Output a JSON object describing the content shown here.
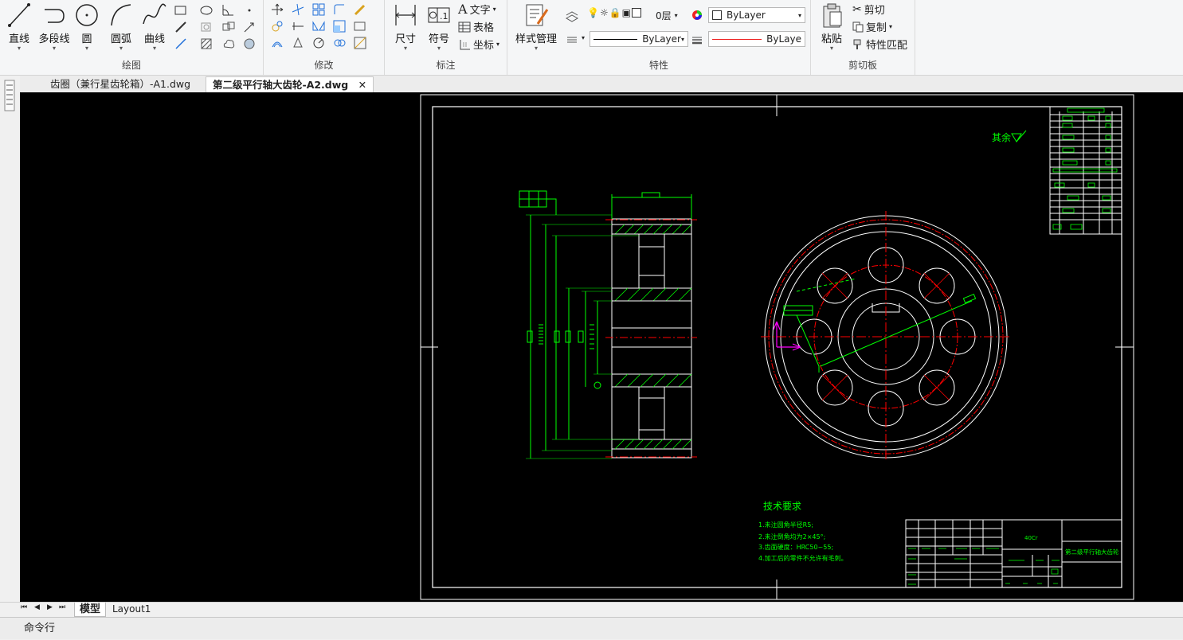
{
  "ribbon": {
    "draw": {
      "title": "绘图",
      "line": "直线",
      "polyline": "多段线",
      "circle": "圆",
      "arc": "圆弧",
      "curve": "曲线"
    },
    "modify": {
      "title": "修改"
    },
    "annotation": {
      "title": "标注",
      "dimension": "尺寸",
      "symbol": "符号",
      "text": "文字",
      "table": "表格",
      "coordinate": "坐标"
    },
    "properties": {
      "title": "特性",
      "style_manager": "样式管理",
      "layer": "0层",
      "color": "ByLayer",
      "linetype": "ByLayer",
      "lineweight": "ByLaye"
    },
    "clipboard": {
      "title": "剪切板",
      "paste": "粘贴",
      "cut": "剪切",
      "copy": "复制",
      "match_properties": "特性匹配"
    }
  },
  "doc_tabs": [
    {
      "label": "齿圈（兼行星齿轮箱）-A1.dwg",
      "active": false
    },
    {
      "label": "第二级平行轴大齿轮-A2.dwg",
      "active": true
    }
  ],
  "layout_tabs": [
    "模型",
    "Layout1"
  ],
  "command_line": "命令行",
  "drawing": {
    "roughness_label": "其余",
    "tech_title": "技术要求",
    "tech_lines": [
      "1.未注圆角半径R5;",
      "2.未注倒角均为2×45°;",
      "3.齿面硬度：HRC50~55;",
      "4.加工后的零件不允许有毛刺。"
    ],
    "material": "40Cr",
    "part_name": "第二级平行轴大齿轮"
  },
  "colors": {
    "canvas": "#000000",
    "line_white": "#ffffff",
    "line_green": "#00ff00",
    "line_red": "#ff0000",
    "line_magenta": "#ff00ff"
  }
}
